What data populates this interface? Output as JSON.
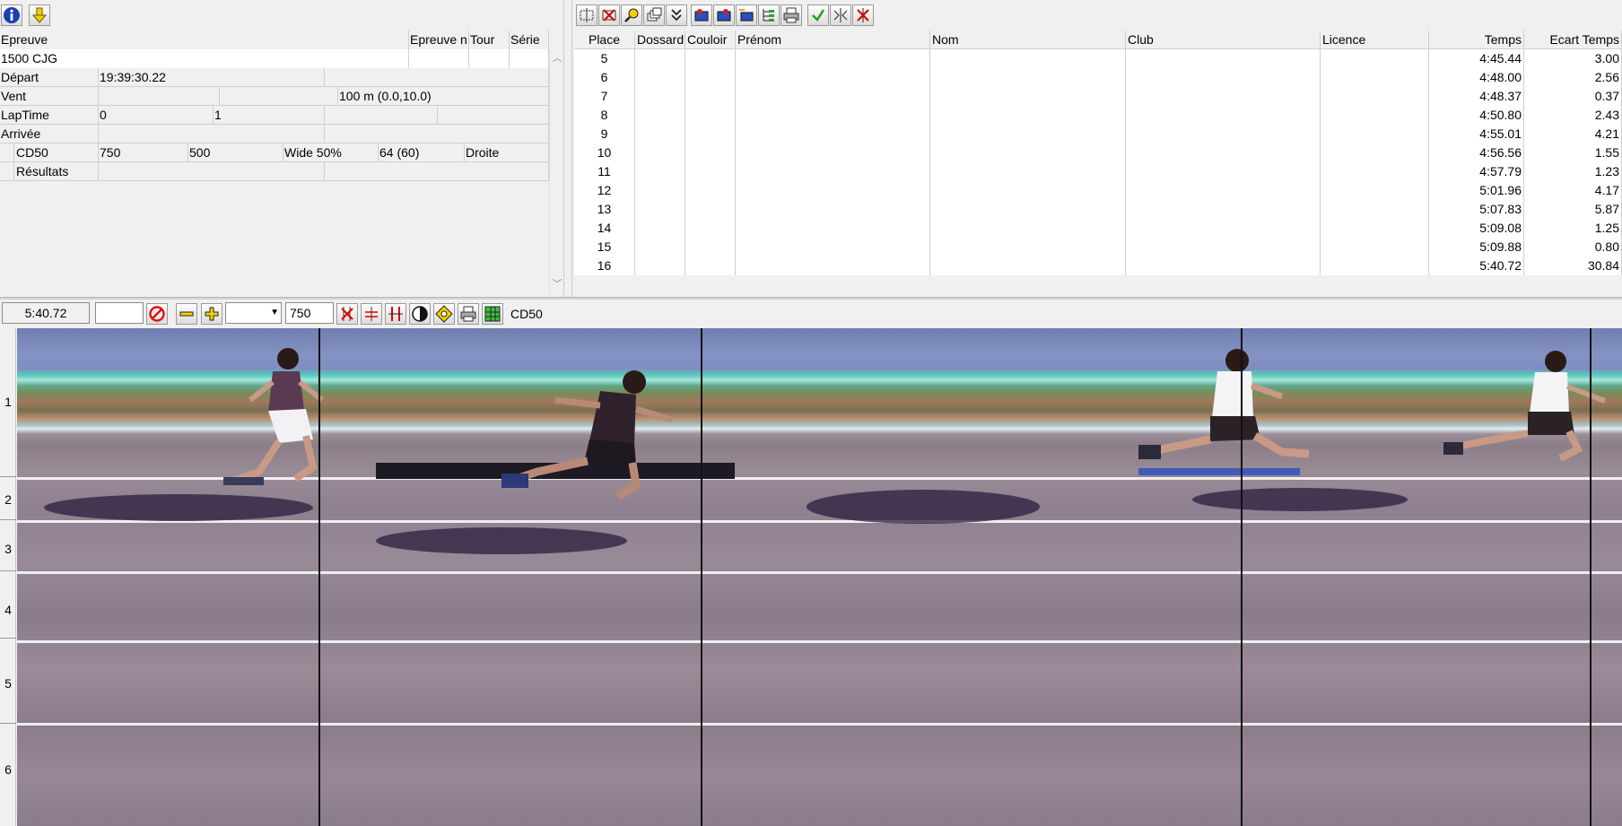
{
  "left_toolbar": {
    "info_icon": "info-icon",
    "download_icon": "arrow-down-icon"
  },
  "event": {
    "headers": {
      "epreuve": "Epreuve",
      "epreuve_n": "Epreuve n",
      "tour": "Tour",
      "serie": "Série"
    },
    "epreuve_value": "1500 CJG",
    "depart_label": "Départ",
    "depart_time": "19:39:30.22",
    "vent_label": "Vent",
    "vent_value": "100 m (0.0,10.0)",
    "laptime_label": "LapTime",
    "laptime_a": "0",
    "laptime_b": "1",
    "arrivee_label": "Arrivée",
    "camera": {
      "name": "CD50",
      "v1": "750",
      "v2": "500",
      "wide": "Wide 50%",
      "v3": "64  (60)",
      "side": "Droite"
    },
    "resultats_label": "Résultats"
  },
  "results": {
    "headers": {
      "place": "Place",
      "dossard": "Dossard",
      "couloir": "Couloir",
      "prenom": "Prénom",
      "nom": "Nom",
      "club": "Club",
      "licence": "Licence",
      "temps": "Temps",
      "ecart": "Ecart Temps"
    },
    "rows": [
      {
        "place": "5",
        "temps": "4:45.44",
        "ecart": "3.00"
      },
      {
        "place": "6",
        "temps": "4:48.00",
        "ecart": "2.56"
      },
      {
        "place": "7",
        "temps": "4:48.37",
        "ecart": "0.37"
      },
      {
        "place": "8",
        "temps": "4:50.80",
        "ecart": "2.43"
      },
      {
        "place": "9",
        "temps": "4:55.01",
        "ecart": "4.21"
      },
      {
        "place": "10",
        "temps": "4:56.56",
        "ecart": "1.55"
      },
      {
        "place": "11",
        "temps": "4:57.79",
        "ecart": "1.23"
      },
      {
        "place": "12",
        "temps": "5:01.96",
        "ecart": "4.17"
      },
      {
        "place": "13",
        "temps": "5:07.83",
        "ecart": "5.87"
      },
      {
        "place": "14",
        "temps": "5:09.08",
        "ecart": "1.25"
      },
      {
        "place": "15",
        "temps": "5:09.88",
        "ecart": "0.80"
      },
      {
        "place": "16",
        "temps": "5:40.72",
        "ecart": "30.84"
      }
    ]
  },
  "image_toolbar": {
    "time_display": "5:40.72",
    "entry_value": "",
    "dropdown_value": "",
    "resolution_value": "750",
    "camera_label": "CD50"
  },
  "lanes": [
    "1",
    "2",
    "3",
    "4",
    "5",
    "6"
  ]
}
